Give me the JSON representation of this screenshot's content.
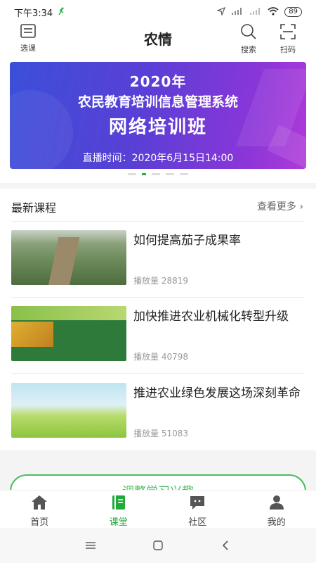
{
  "status_bar": {
    "time": "下午3:34",
    "battery": "89"
  },
  "header": {
    "title": "农情",
    "left_label": "选课",
    "search_label": "搜索",
    "scan_label": "扫码"
  },
  "banner": {
    "year": "2020年",
    "line1": "农民教育培训信息管理系统",
    "line2": "网络培训班",
    "live_time": "直播时间：2020年6月15日14:00"
  },
  "section": {
    "title": "最新课程",
    "more": "查看更多 ›"
  },
  "courses": [
    {
      "title": "如何提高茄子成果率",
      "plays": "播放量 28819"
    },
    {
      "title": "加快推进农业机械化转型升级",
      "plays": "播放量 40798"
    },
    {
      "title": "推进农业绿色发展这场深刻革命",
      "plays": "播放量 51083"
    }
  ],
  "promo": {
    "label": "调整学习兴趣"
  },
  "bottom_nav": [
    {
      "label": "首页",
      "icon": "home-icon"
    },
    {
      "label": "课堂",
      "icon": "book-icon",
      "active": true
    },
    {
      "label": "社区",
      "icon": "chat-icon"
    },
    {
      "label": "我的",
      "icon": "profile-icon"
    }
  ],
  "colors": {
    "accent": "#1faa3a",
    "banner_start": "#3b4fd8",
    "banner_end": "#b03ad8"
  }
}
